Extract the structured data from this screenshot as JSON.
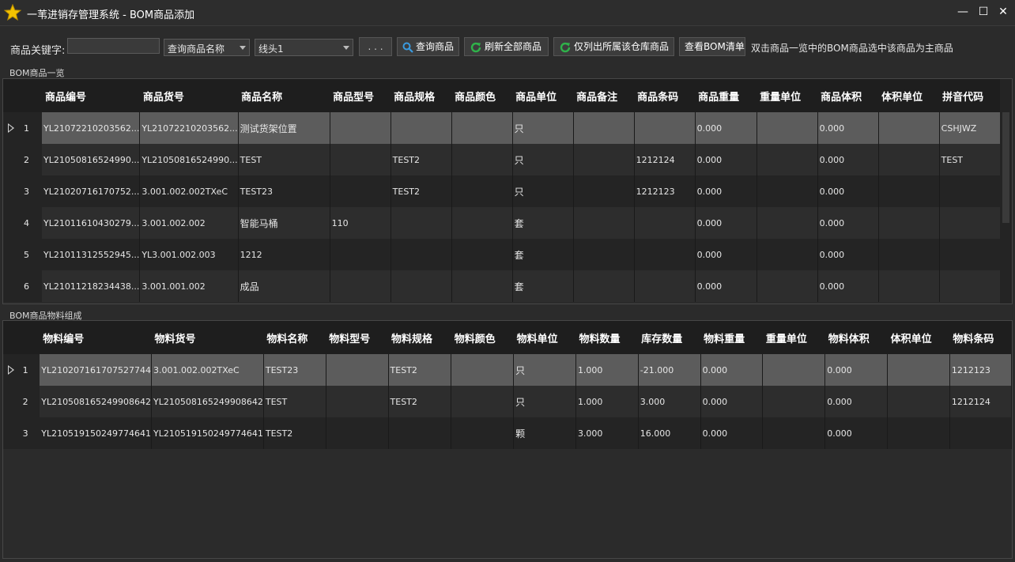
{
  "window": {
    "title": "一苇进销存管理系统 - BOM商品添加",
    "minimize": "—",
    "maximize": "☐",
    "close": "✕",
    "icon": "star-icon"
  },
  "toolbar": {
    "keyword_label": "商品关键字:",
    "keyword_value": "",
    "field_select": "查询商品名称",
    "category_select": "线头1",
    "dots_label": ". . .",
    "query_label": "查询商品",
    "refresh_label": "刷新全部商品",
    "warehouse_label": "仅列出所属该仓库商品",
    "bom_list_label": "查看BOM清单",
    "hint": "双击商品一览中的BOM商品选中该商品为主商品"
  },
  "products": {
    "caption": "BOM商品一览",
    "columns": [
      "商品编号",
      "商品货号",
      "商品名称",
      "商品型号",
      "商品规格",
      "商品颜色",
      "商品单位",
      "商品备注",
      "商品条码",
      "商品重量",
      "重量单位",
      "商品体积",
      "体积单位",
      "拼音代码"
    ],
    "rows": [
      {
        "no": "1",
        "cells": [
          "YL21072210203562...",
          "YL21072210203562...",
          "测试货架位置",
          "",
          "",
          "",
          "只",
          "",
          "",
          "0.000",
          "",
          "0.000",
          "",
          "CSHJWZ"
        ]
      },
      {
        "no": "2",
        "cells": [
          "YL21050816524990...",
          "YL21050816524990...",
          "TEST",
          "",
          "TEST2",
          "",
          "只",
          "",
          "1212124",
          "0.000",
          "",
          "0.000",
          "",
          "TEST"
        ]
      },
      {
        "no": "3",
        "cells": [
          "YL21020716170752...",
          "3.001.002.002TXeC",
          "TEST23",
          "",
          "TEST2",
          "",
          "只",
          "",
          "1212123",
          "0.000",
          "",
          "0.000",
          "",
          ""
        ]
      },
      {
        "no": "4",
        "cells": [
          "YL21011610430279...",
          "3.001.002.002",
          "智能马桶",
          "110",
          "",
          "",
          "套",
          "",
          "",
          "0.000",
          "",
          "0.000",
          "",
          ""
        ]
      },
      {
        "no": "5",
        "cells": [
          "YL21011312552945...",
          "YL3.001.002.003",
          "1212",
          "",
          "",
          "",
          "套",
          "",
          "",
          "0.000",
          "",
          "0.000",
          "",
          ""
        ]
      },
      {
        "no": "6",
        "cells": [
          "YL21011218234438...",
          "3.001.001.002",
          "成品",
          "",
          "",
          "",
          "套",
          "",
          "",
          "0.000",
          "",
          "0.000",
          "",
          ""
        ]
      }
    ]
  },
  "materials": {
    "caption": "BOM商品物料组成",
    "columns": [
      "物料编号",
      "物料货号",
      "物料名称",
      "物料型号",
      "物料规格",
      "物料颜色",
      "物料单位",
      "物料数量",
      "库存数量",
      "物料重量",
      "重量单位",
      "物料体积",
      "体积单位",
      "物料条码"
    ],
    "rows": [
      {
        "no": "1",
        "cells": [
          "YL210207161707527744",
          "3.001.002.002TXeC",
          "TEST23",
          "",
          "TEST2",
          "",
          "只",
          "1.000",
          "-21.000",
          "0.000",
          "",
          "0.000",
          "",
          "1212123"
        ]
      },
      {
        "no": "2",
        "cells": [
          "YL210508165249908642",
          "YL210508165249908642",
          "TEST",
          "",
          "TEST2",
          "",
          "只",
          "1.000",
          "3.000",
          "0.000",
          "",
          "0.000",
          "",
          "1212124"
        ]
      },
      {
        "no": "3",
        "cells": [
          "YL210519150249774641",
          "YL210519150249774641",
          "TEST2",
          "",
          "",
          "",
          "颗",
          "3.000",
          "16.000",
          "0.000",
          "",
          "0.000",
          "",
          ""
        ]
      }
    ]
  },
  "colors": {
    "background": "#2b2b2b",
    "header_bg": "#1e1e1e",
    "selected_row": "#5c5c5c",
    "query_icon": "#3a9be0",
    "refresh_icon": "#2fb24a",
    "star_icon": "#f2c200"
  }
}
